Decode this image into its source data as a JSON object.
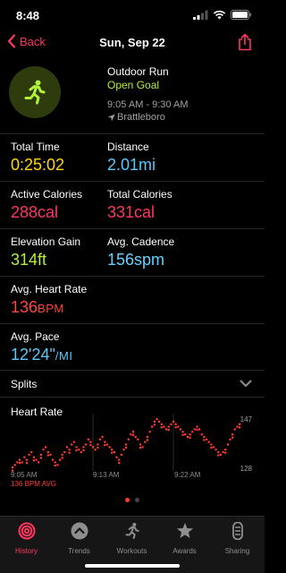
{
  "status_bar": {
    "time": "8:48"
  },
  "nav": {
    "back_label": "Back",
    "title": "Sun, Sep 22"
  },
  "workout": {
    "type": "Outdoor Run",
    "goal": "Open Goal",
    "time_range": "9:05 AM - 9:30 AM",
    "location": "Brattleboro"
  },
  "metrics": {
    "total_time": {
      "label": "Total Time",
      "value": "0:25:02",
      "color": "#ffd60a"
    },
    "distance": {
      "label": "Distance",
      "value": "2.01",
      "unit": "mi",
      "color": "#5ac8fa"
    },
    "active_calories": {
      "label": "Active Calories",
      "value": "288",
      "unit": "cal",
      "color": "#ff375f"
    },
    "total_calories": {
      "label": "Total Calories",
      "value": "331",
      "unit": "cal",
      "color": "#ff375f"
    },
    "elevation_gain": {
      "label": "Elevation Gain",
      "value": "314",
      "unit": "ft",
      "color": "#b4f23a"
    },
    "avg_cadence": {
      "label": "Avg. Cadence",
      "value": "156",
      "unit": "spm",
      "color": "#64d2ff"
    },
    "avg_heart_rate": {
      "label": "Avg. Heart Rate",
      "value": "136",
      "unit": "BPM",
      "color": "#ff453a"
    },
    "avg_pace": {
      "label": "Avg. Pace",
      "value": "12'24\"",
      "unit": "/MI",
      "color": "#5ac8fa"
    }
  },
  "splits": {
    "label": "Splits"
  },
  "heart_rate": {
    "title": "Heart Rate",
    "avg_label": "136 BPM AVG",
    "max_label": "147",
    "min_label": "128",
    "time_labels": [
      "9:05 AM",
      "9:13 AM",
      "9:22 AM"
    ]
  },
  "chart_data": {
    "type": "scatter",
    "title": "Heart Rate",
    "ylim": [
      128,
      147
    ],
    "x_labels": [
      "9:05 AM",
      "9:13 AM",
      "9:22 AM"
    ],
    "series": [
      {
        "values": [
          128,
          129,
          130,
          131,
          130,
          132,
          131,
          133,
          134,
          132,
          131,
          130,
          133,
          135,
          136,
          134,
          133,
          131,
          130,
          129,
          131,
          133,
          134,
          136,
          135,
          137,
          138,
          136,
          135,
          134,
          136,
          137,
          139,
          138,
          136,
          135,
          137,
          139,
          140,
          138,
          137,
          136,
          135,
          134,
          132,
          131,
          133,
          135,
          137,
          139,
          141,
          142,
          140,
          139,
          137,
          136,
          138,
          140,
          142,
          144,
          146,
          147,
          146,
          145,
          144,
          143,
          144,
          145,
          146,
          145,
          144,
          143,
          142,
          141,
          140,
          141,
          142,
          143,
          144,
          143,
          141,
          140,
          139,
          138,
          137,
          136,
          135,
          134,
          133,
          134,
          135,
          137,
          139,
          141,
          143,
          144,
          145
        ]
      }
    ],
    "color": "#ff3b30"
  },
  "tabs": [
    {
      "label": "History",
      "icon": "history-rings-icon",
      "active": true
    },
    {
      "label": "Trends",
      "icon": "trends-chevron-icon",
      "active": false
    },
    {
      "label": "Workouts",
      "icon": "workouts-runner-icon",
      "active": false
    },
    {
      "label": "Awards",
      "icon": "awards-star-icon",
      "active": false
    },
    {
      "label": "Sharing",
      "icon": "sharing-icon",
      "active": false
    }
  ]
}
